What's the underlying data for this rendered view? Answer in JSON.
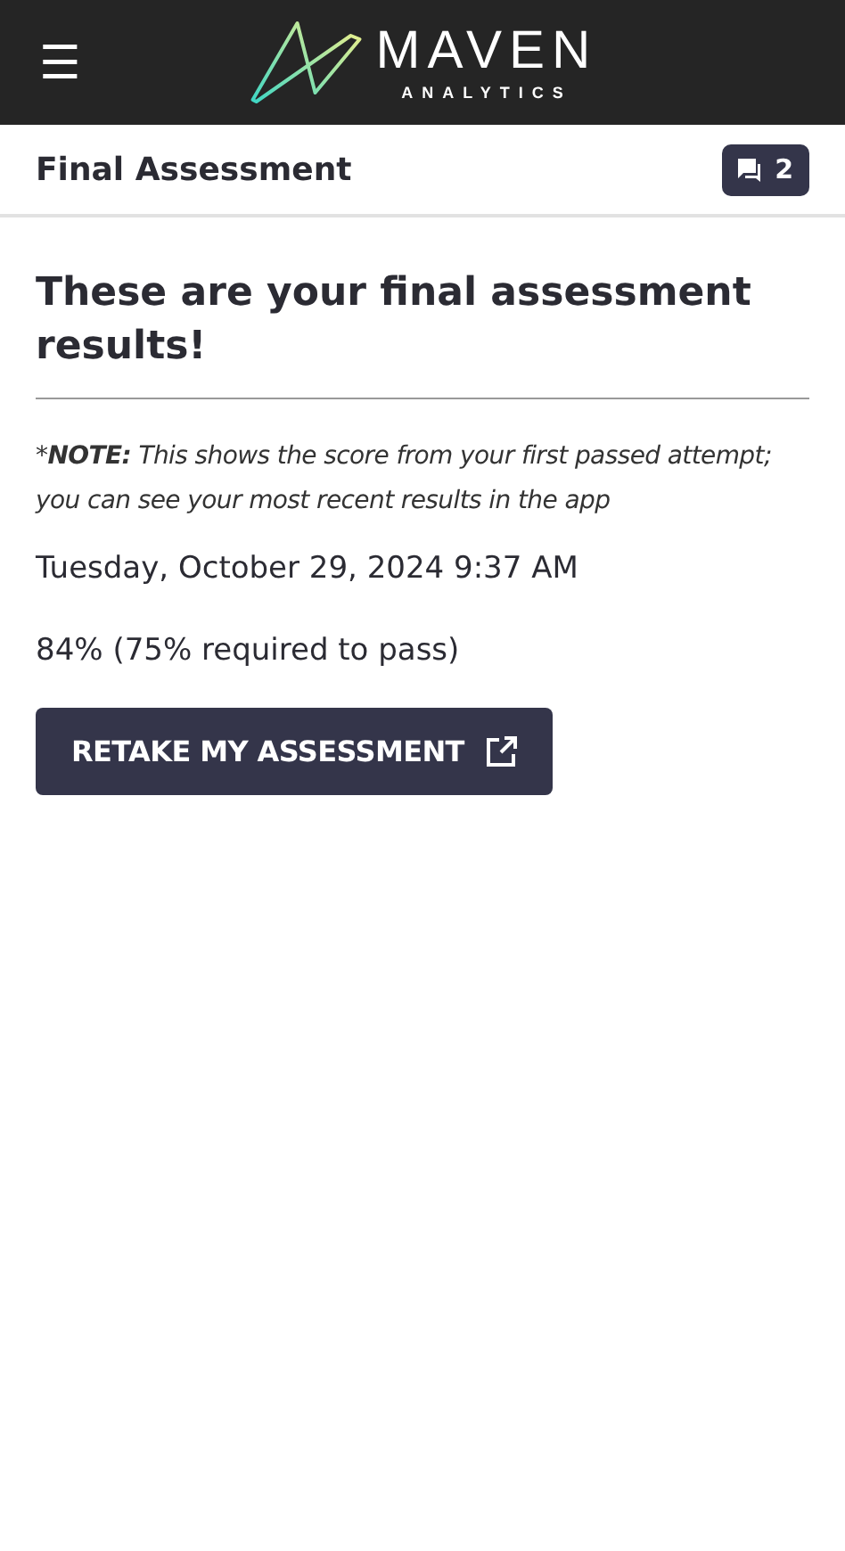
{
  "header": {
    "menu_icon": "☰",
    "logo": {
      "word": "MAVEN",
      "subword": "ANALYTICS"
    }
  },
  "page_bar": {
    "title": "Final Assessment",
    "comments_count": "2"
  },
  "heading": "These are your final assessment results!",
  "note": {
    "marker": "*",
    "label": "NOTE:",
    "text": "This shows the score from your first passed attempt; you can see your most recent results in the app"
  },
  "date": "Tuesday, October 29, 2024 9:37 AM",
  "score": "84% (75% required to pass)",
  "button": {
    "label": "RETAKE MY ASSESSMENT"
  }
}
